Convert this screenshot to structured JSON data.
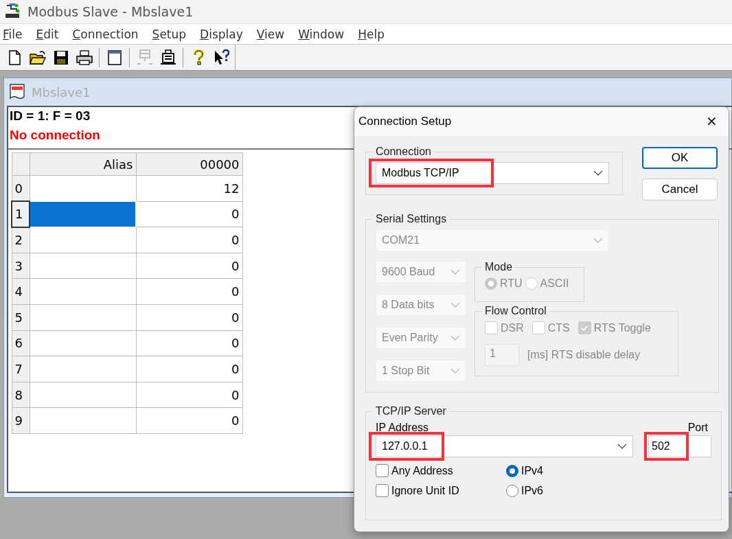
{
  "app": {
    "title": "Modbus Slave - Mbslave1"
  },
  "menu": [
    {
      "label": "File"
    },
    {
      "label": "Edit"
    },
    {
      "label": "Connection"
    },
    {
      "label": "Setup"
    },
    {
      "label": "Display"
    },
    {
      "label": "View"
    },
    {
      "label": "Window"
    },
    {
      "label": "Help"
    }
  ],
  "toolbar": [
    {
      "kind": "new",
      "disabled": false
    },
    {
      "kind": "open",
      "disabled": false
    },
    {
      "kind": "save",
      "disabled": false
    },
    {
      "kind": "print",
      "disabled": false
    },
    {
      "kind": "separator"
    },
    {
      "kind": "window",
      "disabled": false
    },
    {
      "kind": "separator"
    },
    {
      "kind": "connect",
      "disabled": true
    },
    {
      "kind": "disconnect",
      "disabled": false
    },
    {
      "kind": "separator"
    },
    {
      "kind": "help",
      "disabled": false
    },
    {
      "kind": "context-help",
      "disabled": false
    }
  ],
  "child": {
    "title": "Mbslave1",
    "header": "ID = 1: F = 03",
    "status": "No connection",
    "table": {
      "columns": [
        "Alias",
        "00000"
      ],
      "rows": [
        {
          "index": "0",
          "value": "12",
          "selected": false
        },
        {
          "index": "1",
          "value": "0",
          "selected": true
        },
        {
          "index": "2",
          "value": "0",
          "selected": false
        },
        {
          "index": "3",
          "value": "0",
          "selected": false
        },
        {
          "index": "4",
          "value": "0",
          "selected": false
        },
        {
          "index": "5",
          "value": "0",
          "selected": false
        },
        {
          "index": "6",
          "value": "0",
          "selected": false
        },
        {
          "index": "7",
          "value": "0",
          "selected": false
        },
        {
          "index": "8",
          "value": "0",
          "selected": false
        },
        {
          "index": "9",
          "value": "0",
          "selected": false
        }
      ]
    }
  },
  "dialog": {
    "title": "Connection Setup",
    "close": "✕",
    "buttons": [
      {
        "label": "OK",
        "default": true
      },
      {
        "label": "Cancel",
        "default": false
      }
    ],
    "connection": {
      "label": "Connection",
      "value": "Modbus TCP/IP",
      "highlighted": true
    },
    "serial": {
      "label": "Serial Settings",
      "disabled": true,
      "port": "COM21",
      "baud": "9600 Baud",
      "data_bits": "8 Data bits",
      "parity": "Even Parity",
      "stop_bits": "1 Stop Bit",
      "mode": {
        "label": "Mode",
        "options": [
          {
            "label": "RTU",
            "selected": true
          },
          {
            "label": "ASCII",
            "selected": false
          }
        ]
      },
      "flow_control": {
        "label": "Flow Control",
        "options": [
          {
            "label": "DSR",
            "checked": false
          },
          {
            "label": "CTS",
            "checked": false
          },
          {
            "label": "RTS Toggle",
            "checked": true
          }
        ],
        "delay": "1",
        "delay_label": "[ms] RTS disable delay"
      }
    },
    "tcp": {
      "label": "TCP/IP Server",
      "ip_label": "IP Address",
      "ip": "127.0.0.1",
      "ip_highlighted": true,
      "port_label": "Port",
      "port": "502",
      "port_highlighted": true,
      "options": [
        {
          "label": "Any Address",
          "checked": false
        },
        {
          "label": "Ignore Unit ID",
          "checked": false
        }
      ],
      "protocol": [
        {
          "label": "IPv4",
          "selected": true
        },
        {
          "label": "IPv6",
          "selected": false
        }
      ]
    }
  }
}
